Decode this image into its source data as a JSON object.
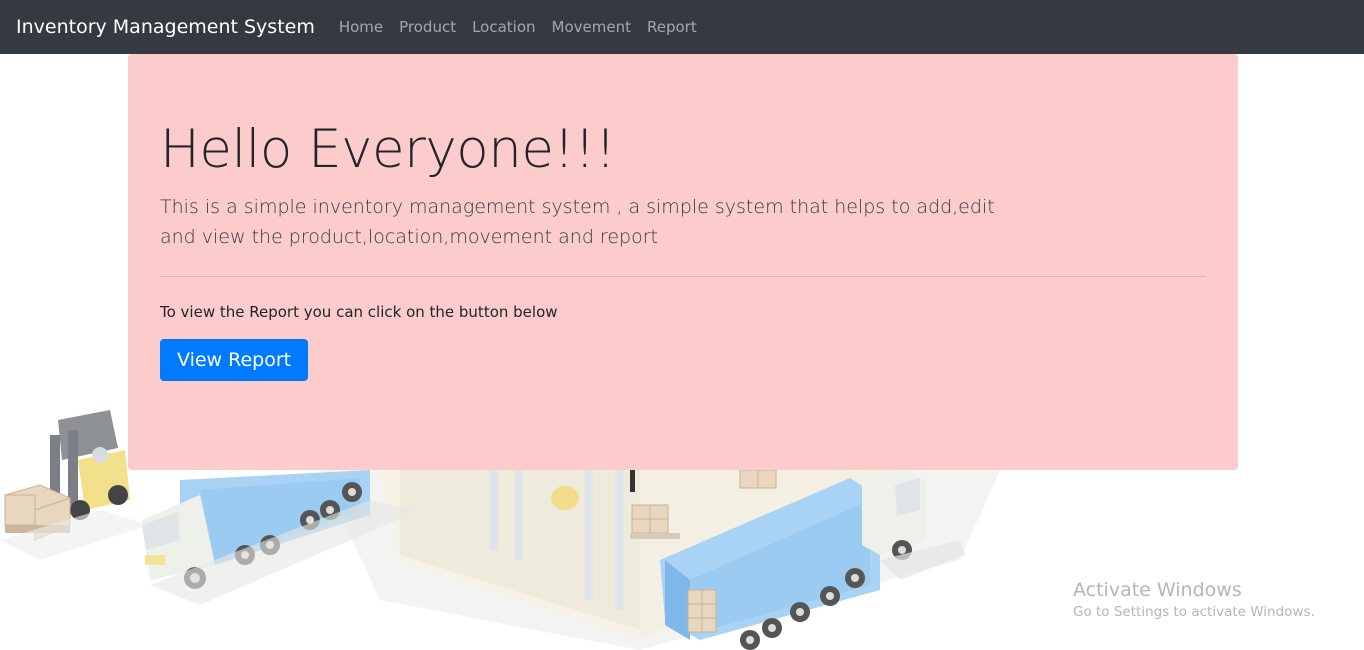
{
  "navbar": {
    "brand": "Inventory Management System",
    "links": [
      "Home",
      "Product",
      "Location",
      "Movement",
      "Report"
    ]
  },
  "hero": {
    "heading": "Hello Everyone!!!",
    "lead": "This is a simple inventory management system , a simple system that helps to add,edit and view the product,location,movement and report",
    "info": "To view the Report you can click on the button below",
    "button_label": "View Report"
  },
  "watermark": {
    "title": "Activate Windows",
    "subtitle": "Go to Settings to activate Windows."
  },
  "colors": {
    "navbar_bg": "#343a40",
    "hero_bg": "#fccbcb",
    "button_bg": "#007bff"
  },
  "background_illustration": "isometric-warehouse-with-trucks-and-forklift"
}
